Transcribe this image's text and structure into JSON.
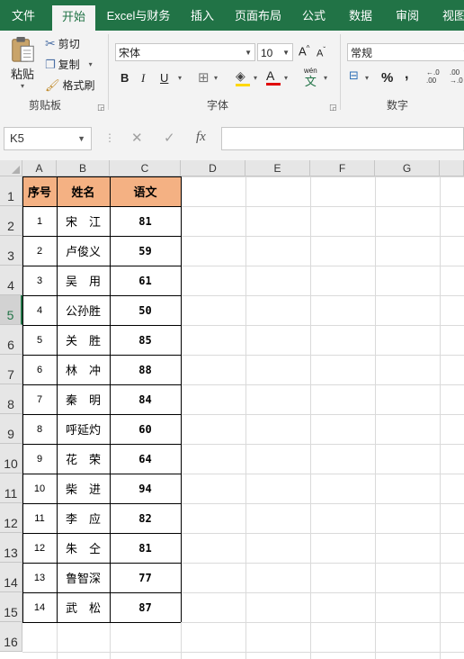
{
  "ribbon": {
    "tabs": [
      "文件",
      "开始",
      "Excel与财务",
      "插入",
      "页面布局",
      "公式",
      "数据",
      "审阅",
      "视图"
    ],
    "active_tab": "开始",
    "clipboard": {
      "paste": "粘贴",
      "cut": "剪切",
      "copy": "复制",
      "format_painter": "格式刷",
      "group_label": "剪贴板"
    },
    "font": {
      "font_name": "宋体",
      "font_size": "10",
      "bold": "B",
      "italic": "I",
      "underline": "U",
      "font_color_glyph": "A",
      "phonetic_glyph": "wén",
      "phonetic_glyph2": "文",
      "group_label": "字体"
    },
    "number": {
      "format": "常规",
      "percent": "%",
      "comma": ",",
      "increase_decimal": "←.0\n.00",
      "decrease_decimal": ".00\n→.0",
      "group_label": "数字"
    }
  },
  "formula_bar": {
    "name_box": "K5",
    "cancel": "✕",
    "enter": "✓",
    "fx": "fx",
    "formula": ""
  },
  "sheet": {
    "columns": [
      "A",
      "B",
      "C",
      "D",
      "E",
      "F",
      "G"
    ],
    "rows": [
      "1",
      "2",
      "3",
      "4",
      "5",
      "6",
      "7",
      "8",
      "9",
      "10",
      "11",
      "12",
      "13",
      "14",
      "15",
      "16"
    ],
    "selected_row": "5",
    "table": {
      "headers": [
        "序号",
        "姓名",
        "语文"
      ],
      "rows": [
        [
          "1",
          "宋　江",
          "81"
        ],
        [
          "2",
          "卢俊义",
          "59"
        ],
        [
          "3",
          "吴　用",
          "61"
        ],
        [
          "4",
          "公孙胜",
          "50"
        ],
        [
          "5",
          "关　胜",
          "85"
        ],
        [
          "6",
          "林　冲",
          "88"
        ],
        [
          "7",
          "秦　明",
          "84"
        ],
        [
          "8",
          "呼延灼",
          "60"
        ],
        [
          "9",
          "花　荣",
          "64"
        ],
        [
          "10",
          "柴　进",
          "94"
        ],
        [
          "11",
          "李　应",
          "82"
        ],
        [
          "12",
          "朱　仝",
          "81"
        ],
        [
          "13",
          "鲁智深",
          "77"
        ],
        [
          "14",
          "武　松",
          "87"
        ]
      ]
    }
  },
  "colors": {
    "accent": "#217346",
    "header_fill": "#f4b183"
  }
}
